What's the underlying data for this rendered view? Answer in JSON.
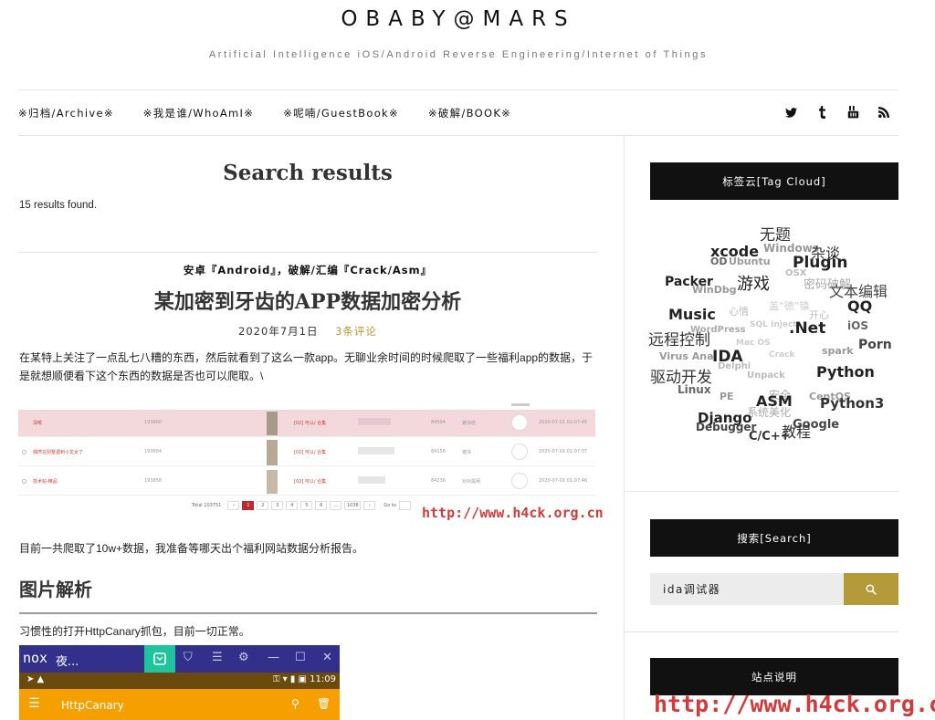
{
  "site": {
    "title": "OBABY@MARS",
    "tagline": "Artificial Intelligence iOS/Android Reverse Engineering/Internet of Things"
  },
  "nav": {
    "items": [
      {
        "label": "※归档/Archive※"
      },
      {
        "label": "※我是谁/WhoAmI※"
      },
      {
        "label": "※呢喃/GuestBook※"
      },
      {
        "label": "※破解/BOOK※"
      }
    ],
    "social_icons": [
      "twitter-icon",
      "tumblr-icon",
      "youtube-icon",
      "rss-icon"
    ]
  },
  "main": {
    "heading": "Search results",
    "results_count": "15 results found.",
    "post": {
      "category_1": "安卓『Android』",
      "separator": "，",
      "category_2": "破解/汇编『Crack/Asm』",
      "title": "某加密到牙齿的APP数据加密分析",
      "date": "2020年7月1日",
      "comments": "3条评论",
      "excerpt": "在某特上关注了一点乱七八糟的东西，然后就看到了这么一款app。无聊业余时间的时候爬取了一些福利app的数据，于是就想顺便看下这个东西的数据是否也可以爬取。\\",
      "paragraph_2": "目前一共爬取了10w+数据，我准备等哪天出个福利网站数据分析报告。",
      "section_heading": "图片解析",
      "paragraph_3": "习惯性的打开HttpCanary抓包，目前一切正常。"
    },
    "table_shot": {
      "rows": [
        {
          "name": "深喉",
          "id": "193860",
          "tag": "[02] 可以/ 合集",
          "count": "84594",
          "status": "被冻结",
          "time": "2020-07-01 01:07:45"
        },
        {
          "name": "偶然在别墅遇到小龙女了",
          "id": "193684",
          "tag": "[02] 可以/ 合集",
          "count": "84156",
          "status": "被冻",
          "time": "2020-07-01 01:07:07"
        },
        {
          "name": "技术帖-精品",
          "id": "193858",
          "tag": "[02] 可以/ 合集",
          "count": "84236",
          "status": "对对黑网",
          "time": "2020-07-01 01:07:46"
        }
      ],
      "pager": {
        "total": "Total 103751",
        "pages": [
          "1",
          "2",
          "3",
          "4",
          "5",
          "6",
          "...",
          "1038"
        ],
        "goto": "Go to"
      },
      "watermark": "http://www.h4ck.org.cn"
    },
    "nox": {
      "brand": "nox",
      "window_title": "夜...",
      "time": "11:09",
      "app_title": "HttpCanary"
    }
  },
  "sidebar": {
    "tag_cloud_title": "标签云[Tag Cloud]",
    "tags": [
      {
        "t": "无题",
        "c": "#333",
        "w": "normal"
      },
      {
        "t": "xcode",
        "c": "#222",
        "w": "bold"
      },
      {
        "t": "Windows",
        "c": "#999",
        "w": "bold"
      },
      {
        "t": "杂谈",
        "c": "#333",
        "w": "normal"
      },
      {
        "t": "OD",
        "c": "#666",
        "w": "bold"
      },
      {
        "t": "Ubuntu",
        "c": "#999",
        "w": "bold"
      },
      {
        "t": "Plugin",
        "c": "#222",
        "w": "bold"
      },
      {
        "t": "OSX",
        "c": "#bbb",
        "w": "bold"
      },
      {
        "t": "Packer",
        "c": "#222",
        "w": "bold"
      },
      {
        "t": "游戏",
        "c": "#222",
        "w": "normal"
      },
      {
        "t": "WinDbg",
        "c": "#999",
        "w": "bold"
      },
      {
        "t": "密码破解",
        "c": "#aaa",
        "w": "normal"
      },
      {
        "t": "文本编辑",
        "c": "#444",
        "w": "normal"
      },
      {
        "t": "QQ",
        "c": "#222",
        "w": "bold"
      },
      {
        "t": "Music",
        "c": "#222",
        "w": "bold"
      },
      {
        "t": "心情",
        "c": "#bbb",
        "w": "normal"
      },
      {
        "t": "盖“德”镇",
        "c": "#ccc",
        "w": "normal"
      },
      {
        "t": "开心",
        "c": "#bbb",
        "w": "normal"
      },
      {
        "t": "WordPress",
        "c": "#aaa",
        "w": "bold"
      },
      {
        "t": "SQL Inject",
        "c": "#ccc",
        "w": "bold"
      },
      {
        "t": ".Net",
        "c": "#222",
        "w": "bold"
      },
      {
        "t": "iOS",
        "c": "#666",
        "w": "bold"
      },
      {
        "t": "远程控制",
        "c": "#333",
        "w": "normal"
      },
      {
        "t": "Mac OS",
        "c": "#ccc",
        "w": "bold"
      },
      {
        "t": "Porn",
        "c": "#444",
        "w": "bold"
      },
      {
        "t": "Virus Anal",
        "c": "#999",
        "w": "bold"
      },
      {
        "t": "IDA",
        "c": "#222",
        "w": "bold"
      },
      {
        "t": "Crack",
        "c": "#ccc",
        "w": "bold"
      },
      {
        "t": "spark",
        "c": "#999",
        "w": "bold"
      },
      {
        "t": "Delphi",
        "c": "#bbb",
        "w": "bold"
      },
      {
        "t": "驱动开发",
        "c": "#333",
        "w": "normal"
      },
      {
        "t": "Unpack",
        "c": "#bbb",
        "w": "bold"
      },
      {
        "t": "Python",
        "c": "#222",
        "w": "bold"
      },
      {
        "t": "Linux",
        "c": "#666",
        "w": "bold"
      },
      {
        "t": "PE",
        "c": "#999",
        "w": "bold"
      },
      {
        "t": "安全",
        "c": "#aaa",
        "w": "normal"
      },
      {
        "t": "CentOS",
        "c": "#999",
        "w": "bold"
      },
      {
        "t": "ASM",
        "c": "#222",
        "w": "bold"
      },
      {
        "t": "Python3",
        "c": "#333",
        "w": "bold"
      },
      {
        "t": "系统美化",
        "c": "#aaa",
        "w": "normal"
      },
      {
        "t": "Django",
        "c": "#222",
        "w": "bold"
      },
      {
        "t": "Debugger",
        "c": "#444",
        "w": "bold"
      },
      {
        "t": "Google",
        "c": "#444",
        "w": "bold"
      },
      {
        "t": "C/C++",
        "c": "#333",
        "w": "bold"
      },
      {
        "t": "教程",
        "c": "#333",
        "w": "normal"
      }
    ],
    "search_title": "搜索[Search]",
    "search_value": "ida调试器",
    "site_info_title": "站点说明",
    "watermark": "http://www.h4ck.org.cn"
  },
  "colors": {
    "accent_gold": "#b59a3a",
    "header_black": "#111111",
    "watermark_red": "#d23b3b",
    "nox_purple": "#32308a",
    "httpcanary_orange": "#f5a000"
  }
}
